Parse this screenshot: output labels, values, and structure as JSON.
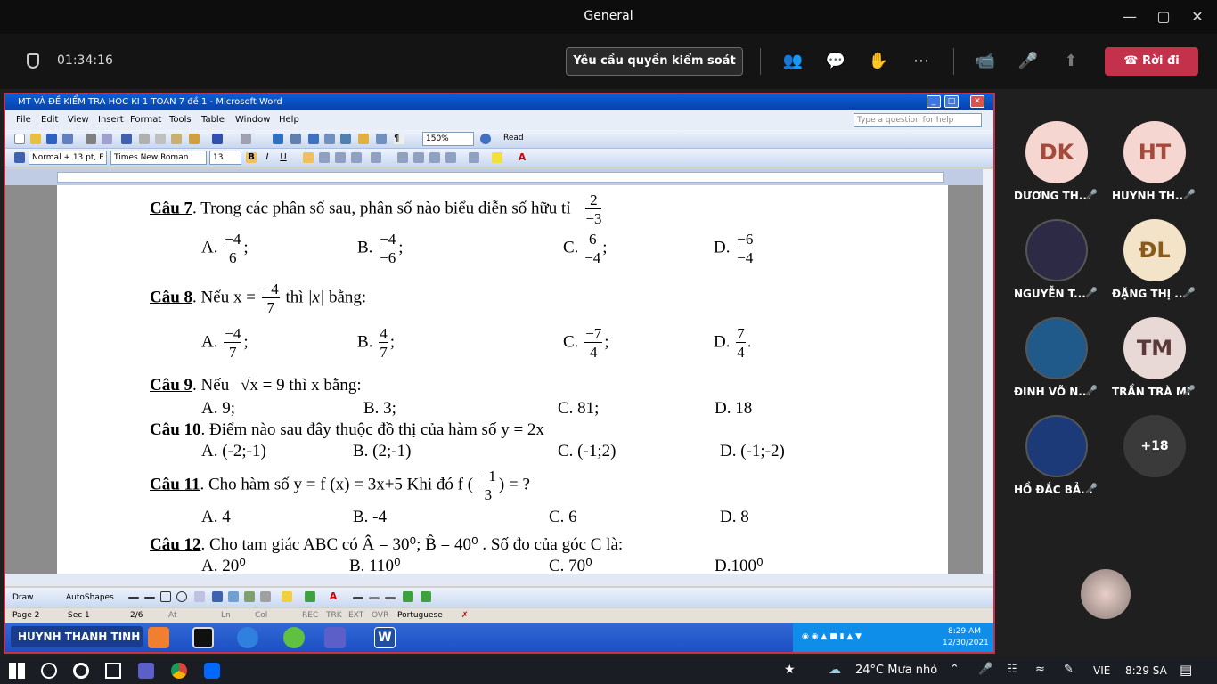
{
  "window_title": "General",
  "meeting": {
    "timer": "01:34:16",
    "request_control": "Yêu cầu quyền kiểm soát",
    "leave": "Rời đi"
  },
  "word": {
    "title": "MT VÀ ĐỀ KIỂM TRA HOC KI 1 TOAN 7 đề 1 - Microsoft Word",
    "menus": [
      "File",
      "Edit",
      "View",
      "Insert",
      "Format",
      "Tools",
      "Table",
      "Window",
      "Help"
    ],
    "help_placeholder": "Type a question for help",
    "zoom": "150%",
    "read": "Read",
    "style": "Normal + 13 pt, E",
    "font": "Times New Roman",
    "size": "13",
    "draw": "Draw",
    "autoshapes": "AutoShapes",
    "status": {
      "page": "Page 2",
      "sec": "Sec 1",
      "pages": "2/6",
      "at": "At",
      "ln": "Ln",
      "col": "Col",
      "rec": "REC",
      "trk": "TRK",
      "ext": "EXT",
      "ovr": "OVR",
      "lang": "Portuguese"
    },
    "presenter": "HUYNH THANH TINH",
    "xp_time": "8:29 AM",
    "xp_date": "12/30/2021"
  },
  "doc": {
    "q7": {
      "label": "Câu 7",
      "text": ". Trong các phân số sau, phân số nào biểu diễn số hữu tỉ",
      "num": "2",
      "den": "−3",
      "opts": [
        {
          "l": "A.",
          "n": "−4",
          "d": "6",
          "s": ";"
        },
        {
          "l": "B.",
          "n": "−4",
          "d": "−6",
          "s": ";"
        },
        {
          "l": "C.",
          "n": "6",
          "d": "−4",
          "s": ";"
        },
        {
          "l": "D.",
          "n": "−6",
          "d": "−4",
          "s": ""
        }
      ]
    },
    "q8": {
      "label": "Câu 8",
      "pre": ". Nếu x =",
      "num": "−4",
      "den": "7",
      "post": "thì",
      "abs": "|x|",
      "end": "bằng:",
      "opts": [
        {
          "l": "A.",
          "n": "−4",
          "d": "7",
          "s": ";"
        },
        {
          "l": "B.",
          "n": "4",
          "d": "7",
          "s": ";"
        },
        {
          "l": "C.",
          "n": "−7",
          "d": "4",
          "s": ";"
        },
        {
          "l": "D.",
          "n": "7",
          "d": "4",
          "s": "."
        }
      ]
    },
    "q9": {
      "label": "Câu 9",
      "pre": ". Nếu",
      "sqrt": "√x = 9",
      "post": "thì  x  bằng:",
      "opts": [
        "A. 9;",
        "B. 3;",
        "C. 81;",
        "D. 18"
      ]
    },
    "q10": {
      "label": "Câu 10",
      "text": ". Điểm nào sau đây thuộc đồ thị của hàm số y = 2x",
      "opts": [
        "A. (-2;-1)",
        "B. (2;-1)",
        "C. (-1;2)",
        "D. (-1;-2)"
      ]
    },
    "q11": {
      "label": "Câu 11",
      "pre": ". Cho hàm số y = f (x) = 3x+5    Khi đó f (",
      "num": "−1",
      "den": "3",
      "post": ") = ?",
      "opts": [
        "A. 4",
        "B. -4",
        "C.  6",
        "D.  8"
      ]
    },
    "q12": {
      "label": "Câu 12",
      "text": ". Cho tam giác ABC có  Â = 30⁰;  B̂ = 40⁰ . Số đo của góc C là:",
      "opts": [
        "A. 20⁰",
        "B. 110⁰",
        "C. 70⁰",
        "D.100⁰"
      ]
    }
  },
  "participants": [
    {
      "initials": "DK",
      "name": "DƯƠNG TH...",
      "bg": "#f5d6d0",
      "fg": "#a34a3a"
    },
    {
      "initials": "HT",
      "name": "HUYNH TH...",
      "bg": "#f5d6d0",
      "fg": "#a34a3a"
    },
    {
      "initials": "",
      "name": "NGUYỄN T...",
      "bg": "#2d2a45",
      "fg": "#fff"
    },
    {
      "initials": "ĐL",
      "name": "ĐẶNG THỊ ...",
      "bg": "#f3e3c8",
      "fg": "#8a5a1a"
    },
    {
      "initials": "",
      "name": "ĐINH VÕ N...",
      "bg": "#1f5a8a",
      "fg": "#fff"
    },
    {
      "initials": "TM",
      "name": "TRẦN TRÀ MI",
      "bg": "#e8d8d6",
      "fg": "#5a3a38"
    },
    {
      "initials": "",
      "name": "HỒ ĐẮC BẢ...",
      "bg": "#1c3a78",
      "fg": "#fff"
    },
    {
      "initials": "+18",
      "name": "",
      "bg": "#3a3a3a",
      "fg": "#fff"
    }
  ],
  "taskbar": {
    "weather": "24°C  Mưa nhỏ",
    "lang": "VIE",
    "time": "8:29 SA"
  }
}
